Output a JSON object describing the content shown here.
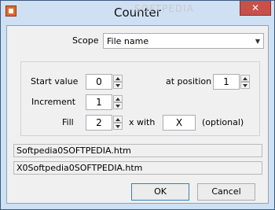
{
  "window": {
    "title": "Counter",
    "close_glyph": "✕",
    "watermark": "SOFTPEDIA"
  },
  "scope": {
    "label": "Scope",
    "value": "File name"
  },
  "group": {
    "start_value_label": "Start value",
    "start_value": "0",
    "at_position_label": "at position",
    "at_position": "1",
    "increment_label": "Increment",
    "increment": "1",
    "fill_label": "Fill",
    "fill": "2",
    "x_with_label": "x with",
    "fill_char": "X",
    "optional_label": "(optional)"
  },
  "preview": {
    "line1": "Softpedia0SOFTPEDIA.htm",
    "line2": "X0Softpedia0SOFTPEDIA.htm"
  },
  "buttons": {
    "ok": "OK",
    "cancel": "Cancel"
  }
}
